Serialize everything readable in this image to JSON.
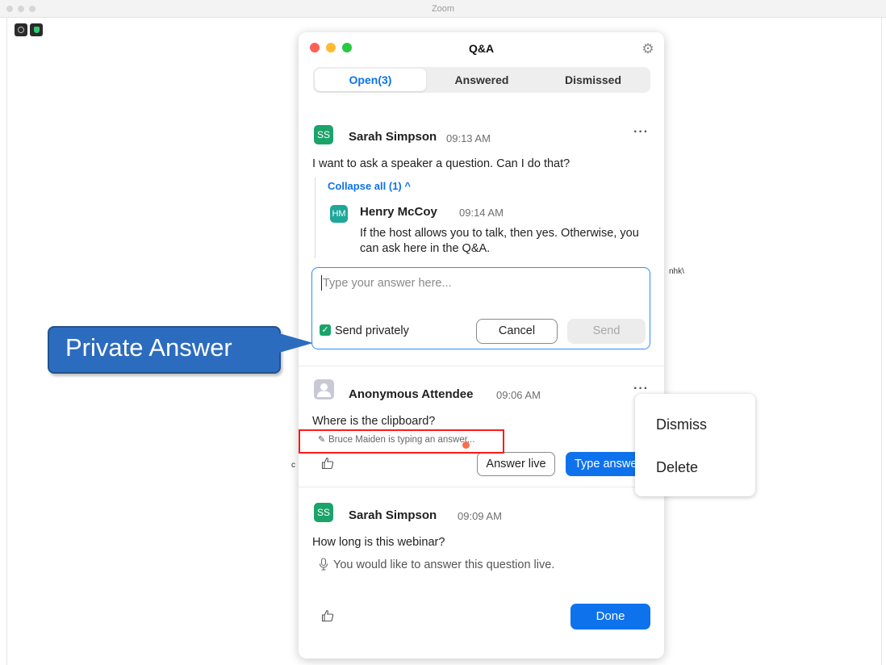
{
  "app": {
    "title": "Zoom"
  },
  "background": {
    "text_right": "nhk\\",
    "text_left": "c"
  },
  "qa_window": {
    "title": "Q&A",
    "tabs": [
      {
        "label": "Open(3)",
        "active": true
      },
      {
        "label": "Answered",
        "active": false
      },
      {
        "label": "Dismissed",
        "active": false
      }
    ],
    "questions": [
      {
        "avatar": "SS",
        "name": "Sarah Simpson",
        "time": "09:13 AM",
        "text": "I want to ask a speaker a question. Can I do that?",
        "collapse_label": "Collapse all (1)",
        "reply": {
          "avatar": "HM",
          "name": "Henry McCoy",
          "time": "09:14 AM",
          "text": "If the host allows you to talk, then yes. Otherwise, you can ask here in the Q&A."
        },
        "answer_box": {
          "placeholder": "Type your answer here...",
          "checkbox_label": "Send privately",
          "checked": true,
          "cancel_label": "Cancel",
          "send_label": "Send"
        }
      },
      {
        "avatar": "",
        "name": "Anonymous Attendee",
        "time": "09:06 AM",
        "text": "Where is the clipboard?",
        "typing_status": "Bruce Maiden is typing an answer...",
        "answer_live_label": "Answer live",
        "type_answer_label": "Type answer"
      },
      {
        "avatar": "SS",
        "name": "Sarah Simpson",
        "time": "09:09 AM",
        "text": "How long is this webinar?",
        "live_note": "You would like to answer this question live.",
        "done_label": "Done"
      }
    ]
  },
  "context_menu": {
    "items": [
      "Dismiss",
      "Delete"
    ]
  },
  "callout": {
    "label": "Private Answer"
  },
  "colors": {
    "accent": "#0e72ed",
    "avatar_green": "#1ba36a",
    "callout": "#2c6cbf",
    "highlight_red": "#ff1a1a"
  }
}
